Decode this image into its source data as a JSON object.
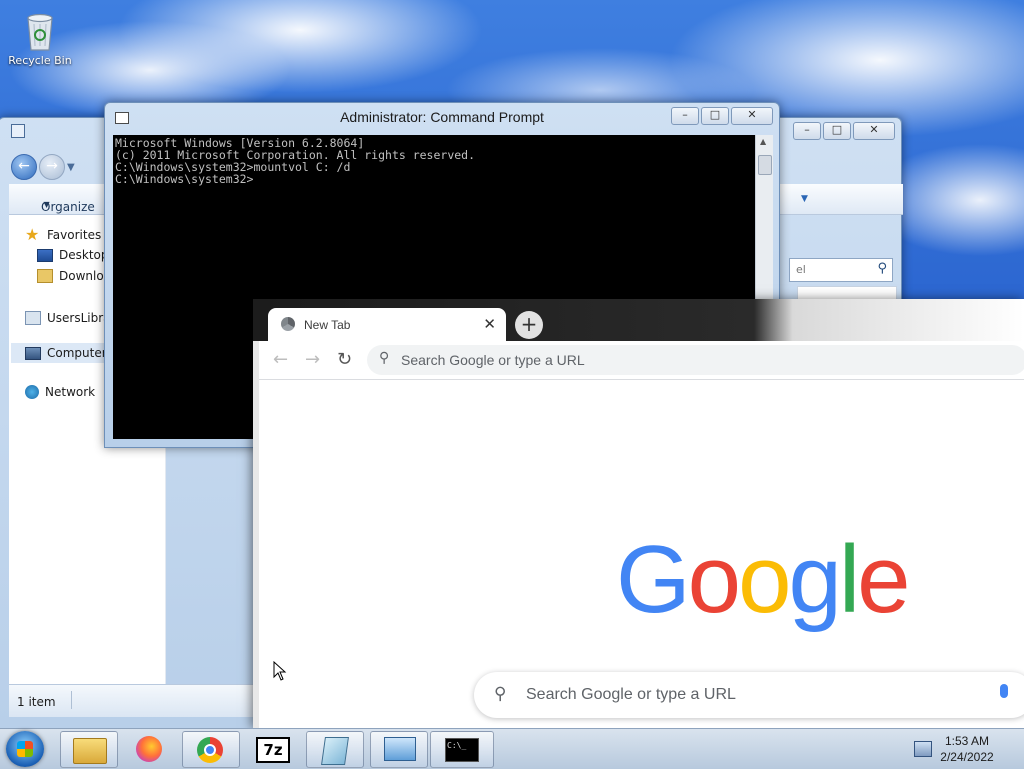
{
  "desktop": {
    "recycle_bin_label": "Recycle Bin"
  },
  "explorer": {
    "organize_label": "Organize",
    "search_placeholder": "el",
    "sidebar": {
      "favorites": "Favorites",
      "desktop": "Desktop",
      "downloads": "Downloa",
      "users_libraries": "UsersLibra",
      "computer": "Computer",
      "network": "Network"
    },
    "status": "1 item"
  },
  "cmd": {
    "title": "Administrator: Command Prompt",
    "lines": [
      "Microsoft Windows [Version 6.2.8064]",
      "(c) 2011 Microsoft Corporation. All rights reserved.",
      "",
      "C:\\Windows\\system32>mountvol C: /d",
      "",
      "C:\\Windows\\system32>"
    ]
  },
  "chrome": {
    "tab_title": "New Tab",
    "omnibox_placeholder": "Search Google or type a URL",
    "logo_text": "Google",
    "ntp_search_placeholder": "Search Google or type a URL"
  },
  "taskbar": {
    "time": "1:53 AM",
    "date": "2/24/2022",
    "sevenzip_label": "7z",
    "cmd_icon_text": "C:\\_"
  },
  "colors": {
    "google_blue": "#4285F4",
    "google_red": "#EA4335",
    "google_yellow": "#FBBC05",
    "google_green": "#34A853"
  }
}
